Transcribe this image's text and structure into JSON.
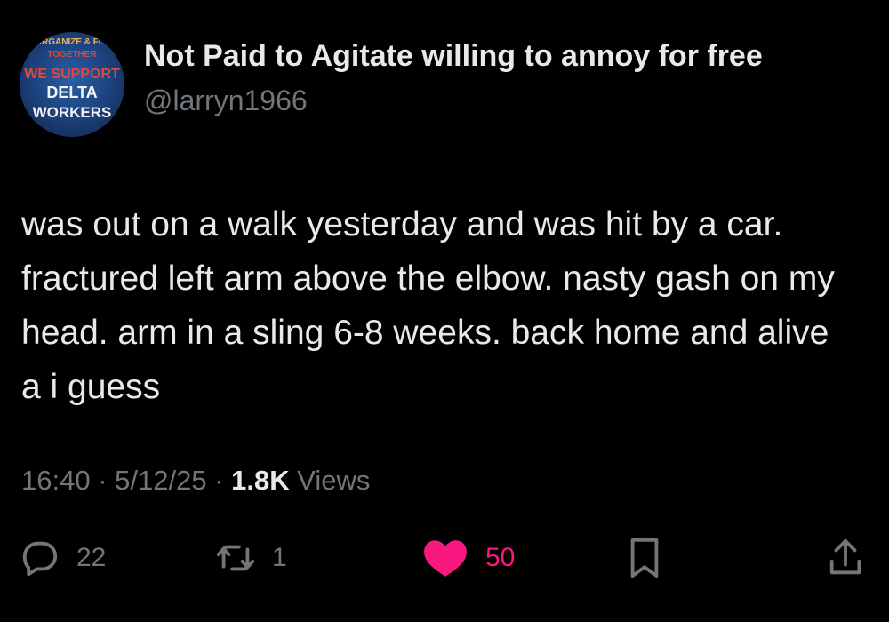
{
  "author": {
    "display_name": "Not Paid to Agitate willing to annoy for free",
    "handle": "@larryn1966",
    "avatar_text": [
      "ORGANIZE & FLY",
      "TOGETHER",
      "WE SUPPORT",
      "DELTA",
      "WORKERS"
    ]
  },
  "tweet": {
    "text": "was out on a walk yesterday and was hit by a car. fractured left arm above the elbow. nasty gash on my head. arm in a sling 6-8 weeks. back home and alive a i guess"
  },
  "meta": {
    "time": "16:40",
    "sep1": " · ",
    "date": "5/12/25",
    "sep2": " · ",
    "views_count": "1.8K",
    "views_label": " Views"
  },
  "actions": {
    "replies": "22",
    "retweets": "1",
    "likes": "50",
    "like_color": "#f91880"
  },
  "icons": [
    "reply-icon",
    "retweet-icon",
    "heart-icon",
    "bookmark-icon",
    "share-icon"
  ]
}
